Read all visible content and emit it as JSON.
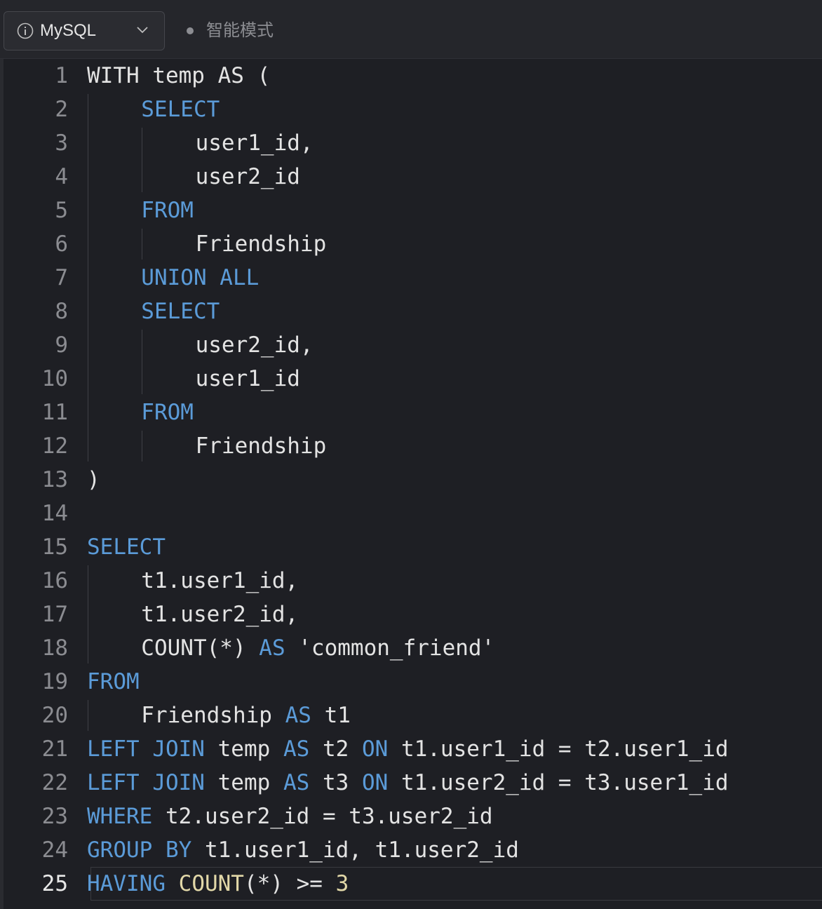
{
  "toolbar": {
    "language": "MySQL",
    "language_icon": "info-icon",
    "dropdown_icon": "chevron-down-icon",
    "mode_label": "智能模式"
  },
  "editor": {
    "active_line": 25,
    "lines": [
      {
        "num": "1",
        "indent": 0,
        "tokens": [
          [
            "tx",
            "WITH temp AS ("
          ]
        ]
      },
      {
        "num": "2",
        "indent": 1,
        "tokens": [
          [
            "kw",
            "SELECT"
          ]
        ]
      },
      {
        "num": "3",
        "indent": 2,
        "tokens": [
          [
            "tx",
            "user1_id,"
          ]
        ]
      },
      {
        "num": "4",
        "indent": 2,
        "tokens": [
          [
            "tx",
            "user2_id"
          ]
        ]
      },
      {
        "num": "5",
        "indent": 1,
        "tokens": [
          [
            "kw",
            "FROM"
          ]
        ]
      },
      {
        "num": "6",
        "indent": 2,
        "tokens": [
          [
            "tx",
            "Friendship"
          ]
        ]
      },
      {
        "num": "7",
        "indent": 1,
        "tokens": [
          [
            "kw",
            "UNION ALL"
          ]
        ]
      },
      {
        "num": "8",
        "indent": 1,
        "tokens": [
          [
            "kw",
            "SELECT"
          ]
        ]
      },
      {
        "num": "9",
        "indent": 2,
        "tokens": [
          [
            "tx",
            "user2_id,"
          ]
        ]
      },
      {
        "num": "10",
        "indent": 2,
        "tokens": [
          [
            "tx",
            "user1_id"
          ]
        ]
      },
      {
        "num": "11",
        "indent": 1,
        "tokens": [
          [
            "kw",
            "FROM"
          ]
        ]
      },
      {
        "num": "12",
        "indent": 2,
        "tokens": [
          [
            "tx",
            "Friendship"
          ]
        ]
      },
      {
        "num": "13",
        "indent": 0,
        "tokens": [
          [
            "tx",
            ")"
          ]
        ]
      },
      {
        "num": "14",
        "indent": 0,
        "tokens": []
      },
      {
        "num": "15",
        "indent": 0,
        "tokens": [
          [
            "kw",
            "SELECT"
          ]
        ]
      },
      {
        "num": "16",
        "indent": 1,
        "tokens": [
          [
            "tx",
            "t1.user1_id,"
          ]
        ]
      },
      {
        "num": "17",
        "indent": 1,
        "tokens": [
          [
            "tx",
            "t1.user2_id,"
          ]
        ]
      },
      {
        "num": "18",
        "indent": 1,
        "tokens": [
          [
            "tx",
            "COUNT(*) "
          ],
          [
            "kw",
            "AS"
          ],
          [
            "tx",
            " 'common_friend'"
          ]
        ]
      },
      {
        "num": "19",
        "indent": 0,
        "tokens": [
          [
            "kw",
            "FROM"
          ]
        ]
      },
      {
        "num": "20",
        "indent": 1,
        "tokens": [
          [
            "tx",
            "Friendship "
          ],
          [
            "kw",
            "AS"
          ],
          [
            "tx",
            " t1"
          ]
        ]
      },
      {
        "num": "21",
        "indent": 0,
        "tokens": [
          [
            "kw",
            "LEFT JOIN"
          ],
          [
            "tx",
            " temp "
          ],
          [
            "kw",
            "AS"
          ],
          [
            "tx",
            " t2 "
          ],
          [
            "kw",
            "ON"
          ],
          [
            "tx",
            " t1.user1_id = t2.user1_id"
          ]
        ]
      },
      {
        "num": "22",
        "indent": 0,
        "tokens": [
          [
            "kw",
            "LEFT JOIN"
          ],
          [
            "tx",
            " temp "
          ],
          [
            "kw",
            "AS"
          ],
          [
            "tx",
            " t3 "
          ],
          [
            "kw",
            "ON"
          ],
          [
            "tx",
            " t1.user2_id = t3.user1_id"
          ]
        ]
      },
      {
        "num": "23",
        "indent": 0,
        "tokens": [
          [
            "kw",
            "WHERE"
          ],
          [
            "tx",
            " t2.user2_id = t3.user2_id"
          ]
        ]
      },
      {
        "num": "24",
        "indent": 0,
        "tokens": [
          [
            "kw",
            "GROUP BY"
          ],
          [
            "tx",
            " t1.user1_id, t1.user2_id"
          ]
        ]
      },
      {
        "num": "25",
        "indent": 0,
        "tokens": [
          [
            "kw",
            "HAVING"
          ],
          [
            "tx",
            " "
          ],
          [
            "fn",
            "COUNT"
          ],
          [
            "tx",
            "(*) >= "
          ],
          [
            "num",
            "3"
          ]
        ]
      }
    ]
  }
}
